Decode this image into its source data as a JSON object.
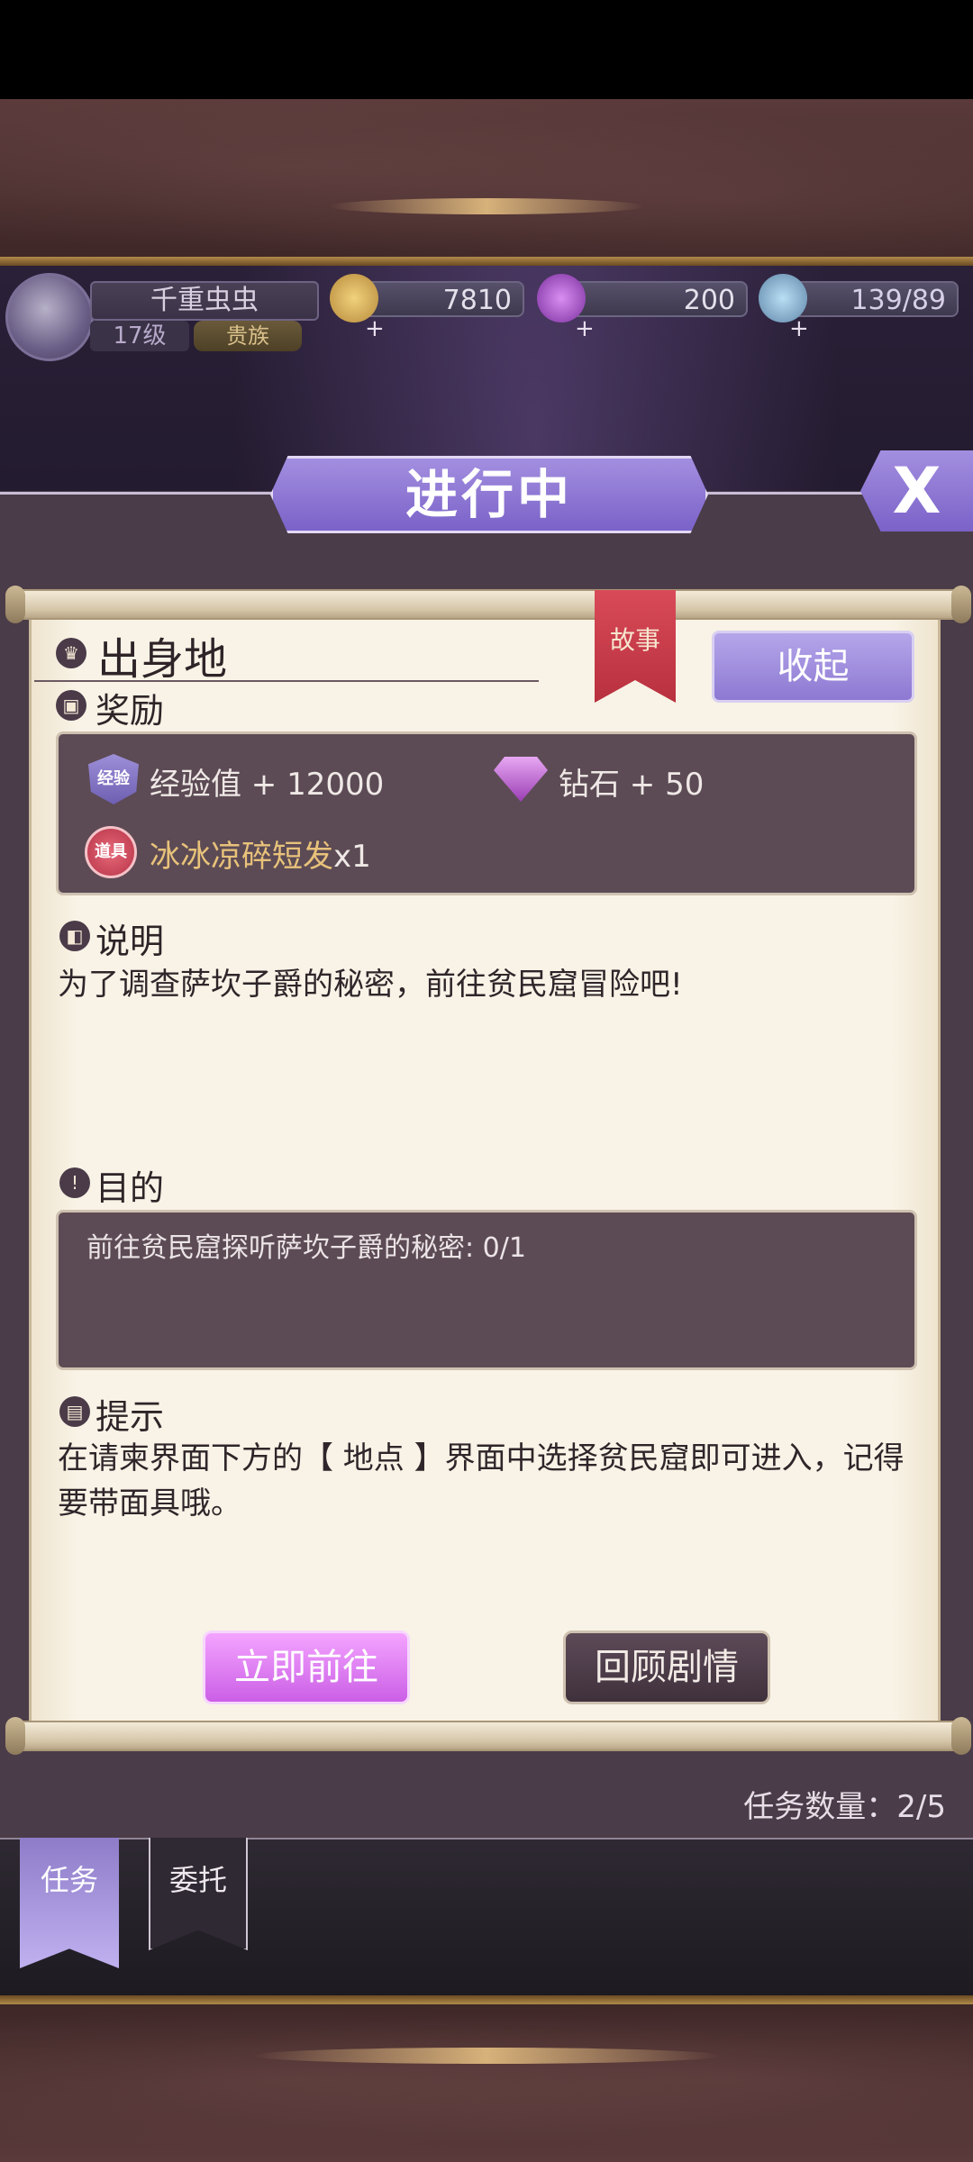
{
  "hud": {
    "player_name": "千重虫虫",
    "level": "17级",
    "title_badge": "贵族",
    "gold": "7810",
    "diamonds": "200",
    "stamina": "139/89"
  },
  "header": {
    "status": "进行中",
    "close_label": "X"
  },
  "quest": {
    "origin_title": "出身地",
    "story_tag": "故事",
    "collapse_label": "收起",
    "reward_heading": "奖励",
    "rewards": {
      "exp_badge": "经验",
      "exp_text": "经验值 + 12000",
      "diamond_text": "钻石 + 50",
      "item_badge": "道具",
      "item_name": "冰冰凉碎短发",
      "item_qty": "x1"
    },
    "desc_heading": "说明",
    "desc_text": "为了调查萨坎子爵的秘密，前往贫民窟冒险吧!",
    "goal_heading": "目的",
    "goal_text": "前往贫民窟探听萨坎子爵的秘密: 0/1",
    "hint_heading": "提示",
    "hint_text": "在请柬界面下方的【 地点 】界面中选择贫民窟即可进入，记得要带面具哦。",
    "go_button": "立即前往",
    "review_button": "回顾剧情",
    "count_text": "任务数量：2/5"
  },
  "tabs": {
    "task": "任务",
    "commission": "委托"
  },
  "colors": {
    "accent_purple": "#8d79d2",
    "go_pink": "#cb5fe6",
    "story_red": "#c73744",
    "parchment": "#f8f3e6"
  }
}
